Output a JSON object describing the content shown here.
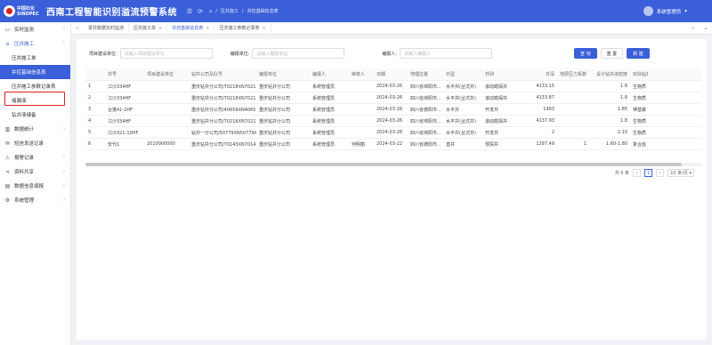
{
  "header": {
    "logo_cn": "中国石化",
    "logo_en": "SINOPEC",
    "title": "西南工程智能识别溢流预警系统",
    "breadcrumb": [
      "压井施工",
      "井控基础信息表"
    ],
    "user": "系统管理员"
  },
  "sidebar": {
    "items": [
      {
        "label": "实时监测",
        "icon": "monitor-icon",
        "chev": "›"
      },
      {
        "label": "压井施工",
        "icon": "home-icon",
        "chev": "˄"
      },
      {
        "label": "压井施工单",
        "sub": true
      },
      {
        "label": "井控基础信息表",
        "sub": true
      },
      {
        "label": "压井施工参数记录表",
        "sub": true
      },
      {
        "label": "堵漏液",
        "sub": true
      },
      {
        "label": "钻井液储备",
        "sub": true
      },
      {
        "label": "数据统计",
        "icon": "chart-icon",
        "chev": "›"
      },
      {
        "label": "短信发送记录",
        "icon": "message-icon"
      },
      {
        "label": "报警记录",
        "icon": "alarm-icon",
        "chev": "›"
      },
      {
        "label": "资料共享",
        "icon": "share-icon",
        "chev": "›"
      },
      {
        "label": "数据信息填报",
        "icon": "form-icon",
        "chev": "›"
      },
      {
        "label": "系统管理",
        "icon": "gear-icon",
        "chev": "›"
      }
    ]
  },
  "tabs": [
    {
      "label": "录井数据实时监测",
      "closable": false
    },
    {
      "label": "压井施工单",
      "closable": true
    },
    {
      "label": "井控基础信息表",
      "closable": true,
      "active": true
    },
    {
      "label": "压井施工参数记录表",
      "closable": true
    }
  ],
  "filters": {
    "project_unit_label": "项目建设单位:",
    "project_unit_placeholder": "请输入项目建设单位",
    "compile_unit_label": "编报单位:",
    "compile_unit_placeholder": "请输入编报单位",
    "compiler_label": "编报人:",
    "compiler_placeholder": "请输入编报人"
  },
  "buttons": {
    "search": "查 询",
    "reset": "重 置",
    "add": "新 建"
  },
  "table": {
    "columns": [
      "",
      "井号",
      "项目建设单位",
      "钻井公司及队号",
      "编报单位",
      "编报人",
      "审核人",
      "日期",
      "地理位置",
      "井型",
      "井别",
      "井深",
      "地层压力系数",
      "设计钻井液密度",
      "实际钻井"
    ],
    "rows": [
      [
        "1",
        "江沙334HF",
        "",
        "重庆钻井分公司/70218XN70218XN",
        "重庆钻井分公司",
        "系统管理员",
        "",
        "2024-03-26",
        "四川省绵阳市...",
        "水平井(丛式井)",
        "滚动勘探井",
        "4133.15",
        "",
        "1.8",
        "生物质"
      ],
      [
        "2",
        "江沙334HF",
        "",
        "重庆钻井分公司/70218XN70218XN",
        "重庆钻井分公司",
        "系统管理员",
        "",
        "2024-03-26",
        "四川省绵阳市...",
        "水平井(丛式井)",
        "滚动勘探井",
        "4133.87",
        "",
        "1.8",
        "生物质"
      ],
      [
        "3",
        "合蓬41-2HF",
        "",
        "重庆钻井分公司/40659XN40659XN",
        "重庆钻井分公司",
        "系统管理员",
        "",
        "2024-03-26",
        "四川省德阳市...",
        "水平井",
        "开发井",
        "1903",
        "",
        "1.85",
        "钾基聚"
      ],
      [
        "4",
        "江沙334HF",
        "",
        "重庆钻井分公司/70218XN70218XN",
        "重庆钻井分公司",
        "系统管理员",
        "",
        "2024-03-26",
        "四川省绵阳市...",
        "水平井(丛式井)",
        "滚动勘探井",
        "4137.93",
        "",
        "1.8",
        "生物质"
      ],
      [
        "5",
        "江沙321-10HF",
        "",
        "钻井一分公司/50779XN50779XN",
        "重庆钻井分公司",
        "系统管理员",
        "",
        "2024-03-26",
        "四川省绵阳市...",
        "水平井(丛式井)",
        "开发井",
        "2",
        "",
        "2,10",
        "生物质"
      ],
      [
        "6",
        "安代1",
        "2010000000",
        "重庆钻井分公司/70143XN70143XN",
        "重庆钻井分公司",
        "系统管理员",
        "何明丽",
        "2024-03-22",
        "四川省德阳市...",
        "直井",
        "预探井",
        "1297.49",
        "1",
        "1.60-1.80",
        "复合盐"
      ]
    ]
  },
  "pagination": {
    "total": "共 6 条",
    "page": "1",
    "size": "10 条/页"
  }
}
